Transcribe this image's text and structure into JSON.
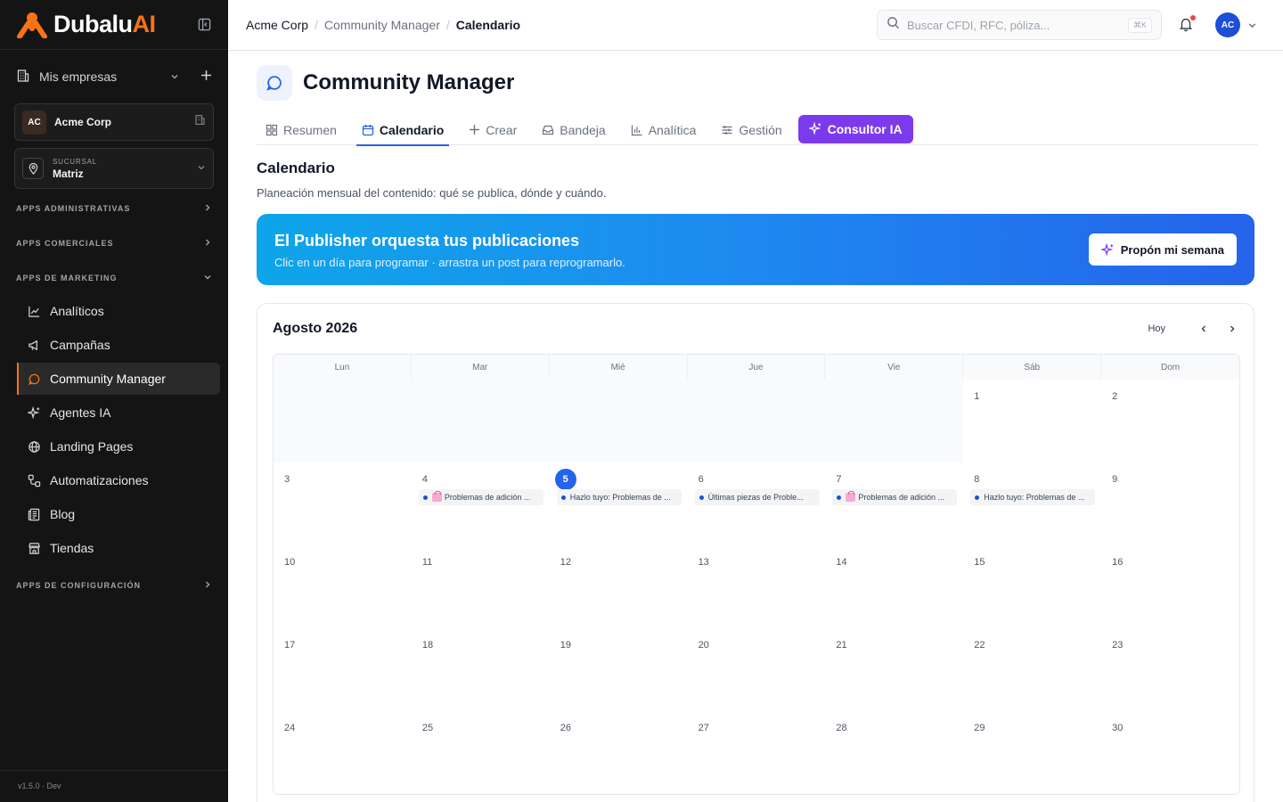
{
  "brand": {
    "name": "Dubalu",
    "suffix": "AI",
    "accent": "#f97316"
  },
  "sidebar": {
    "my_companies": "Mis empresas",
    "company": {
      "initials": "AC",
      "name": "Acme Corp"
    },
    "branch": {
      "caption": "SUCURSAL",
      "value": "Matriz"
    },
    "groups": {
      "admin": "APPS ADMINISTRATIVAS",
      "commercial": "APPS COMERCIALES",
      "marketing": "APPS DE MARKETING",
      "config": "APPS DE CONFIGURACIÓN"
    },
    "marketing_items": [
      {
        "label": "Analíticos",
        "icon": "chart-line-icon"
      },
      {
        "label": "Campañas",
        "icon": "megaphone-icon"
      },
      {
        "label": "Community Manager",
        "icon": "chat-bubble-icon"
      },
      {
        "label": "Agentes IA",
        "icon": "sparkles-icon"
      },
      {
        "label": "Landing Pages",
        "icon": "globe-icon"
      },
      {
        "label": "Automatizaciones",
        "icon": "workflow-icon"
      },
      {
        "label": "Blog",
        "icon": "newspaper-icon"
      },
      {
        "label": "Tiendas",
        "icon": "store-icon"
      }
    ],
    "version": "v1.5.0 · Dev"
  },
  "topbar": {
    "breadcrumb": [
      "Acme Corp",
      "Community Manager",
      "Calendario"
    ],
    "search_placeholder": "Buscar CFDI, RFC, póliza...",
    "search_shortcut": "⌘K",
    "user_initials": "AC"
  },
  "page": {
    "title": "Community Manager",
    "tabs": [
      {
        "label": "Resumen",
        "icon": "grid-icon"
      },
      {
        "label": "Calendario",
        "icon": "calendar-icon"
      },
      {
        "label": "Crear",
        "icon": "plus-icon"
      },
      {
        "label": "Bandeja",
        "icon": "inbox-icon"
      },
      {
        "label": "Analítica",
        "icon": "bar-chart-icon"
      },
      {
        "label": "Gestión",
        "icon": "sliders-icon"
      },
      {
        "label": "Consultor IA",
        "icon": "sparkles-icon"
      }
    ],
    "section_title": "Calendario",
    "section_subtitle": "Planeación mensual del contenido: qué se publica, dónde y cuándo."
  },
  "banner": {
    "title": "El Publisher orquesta tus publicaciones",
    "subtitle": "Clic en un día para programar · arrastra un post para reprogramarlo.",
    "button": "Propón mi semana"
  },
  "calendar": {
    "month": "Agosto 2026",
    "today_label": "Hoy",
    "weekdays": [
      "Lun",
      "Mar",
      "Mié",
      "Jue",
      "Vie",
      "Sáb",
      "Dom"
    ],
    "weeks": [
      [
        "",
        "",
        "",
        "",
        "",
        "1",
        "2"
      ],
      [
        "3",
        "4",
        "5",
        "6",
        "7",
        "8",
        "9"
      ],
      [
        "10",
        "11",
        "12",
        "13",
        "14",
        "15",
        "16"
      ],
      [
        "17",
        "18",
        "19",
        "20",
        "21",
        "22",
        "23"
      ],
      [
        "24",
        "25",
        "26",
        "27",
        "28",
        "29",
        "30"
      ]
    ],
    "today": "5",
    "events": {
      "4": "Problemas de adición ...",
      "5": "Hazlo tuyo: Problemas de ...",
      "6": "Últimas piezas de Proble...",
      "7": "Problemas de adición ...",
      "8": "Hazlo tuyo: Problemas de ..."
    }
  }
}
